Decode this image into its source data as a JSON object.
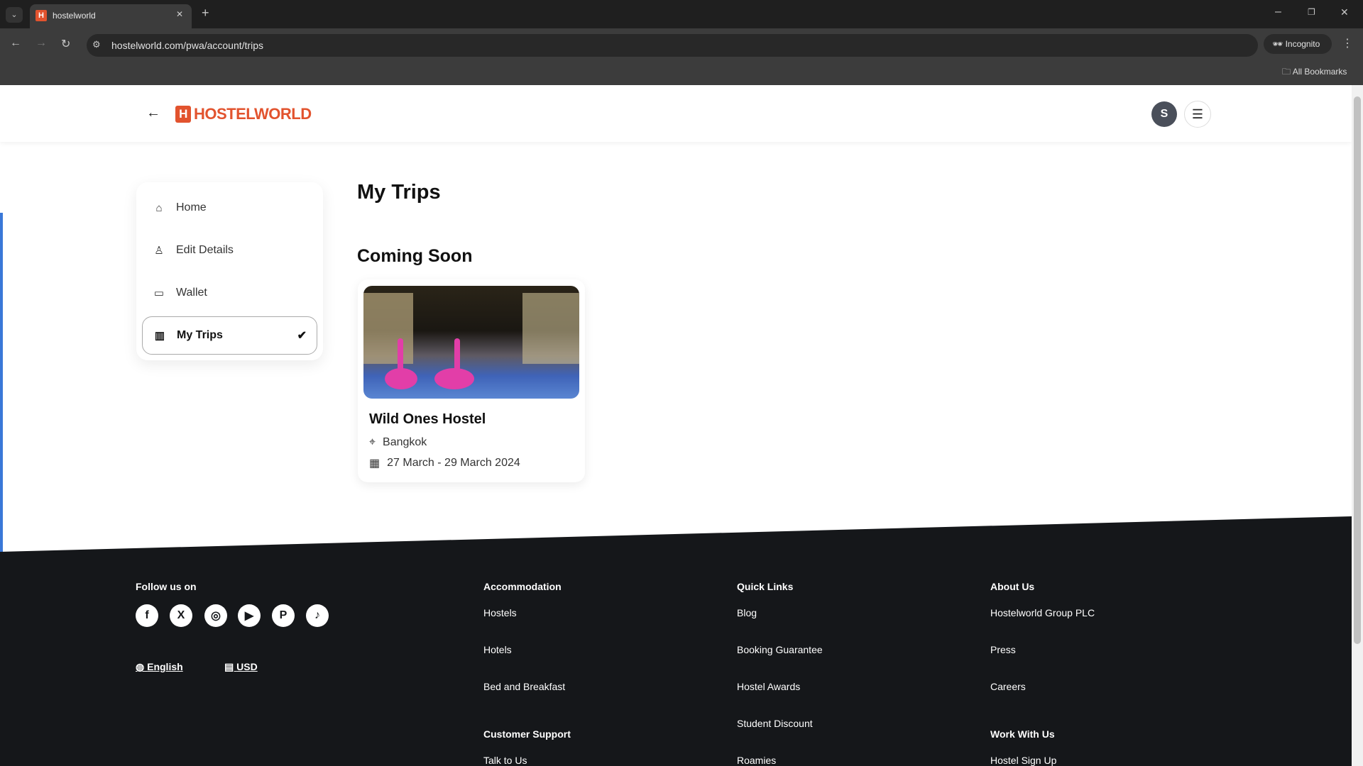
{
  "browser": {
    "tab_title": "hostelworld",
    "url": "hostelworld.com/pwa/account/trips",
    "profile_label": "Incognito",
    "bookmarks_label": "All Bookmarks"
  },
  "header": {
    "logo_text": "HOSTELWORLD",
    "avatar_initial": "S"
  },
  "sidebar": {
    "items": [
      {
        "label": "Home",
        "icon": "home-icon"
      },
      {
        "label": "Edit Details",
        "icon": "user-icon"
      },
      {
        "label": "Wallet",
        "icon": "wallet-icon"
      },
      {
        "label": "My Trips",
        "icon": "map-icon",
        "selected": true
      }
    ]
  },
  "main": {
    "title": "My Trips",
    "section": "Coming Soon",
    "trip": {
      "name": "Wild Ones Hostel",
      "city": "Bangkok",
      "dates": "27 March - 29 March 2024"
    }
  },
  "footer": {
    "follow": "Follow us on",
    "socials": [
      "facebook",
      "x",
      "instagram",
      "youtube",
      "pinterest",
      "tiktok"
    ],
    "language": "English",
    "currency": "USD",
    "accommodation": {
      "title": "Accommodation",
      "links": [
        "Hostels",
        "Hotels",
        "Bed and Breakfast"
      ]
    },
    "support": {
      "title": "Customer Support",
      "links": [
        "Talk to Us"
      ]
    },
    "quick": {
      "title": "Quick Links",
      "links": [
        "Blog",
        "Booking Guarantee",
        "Hostel Awards",
        "Student Discount",
        "Roamies"
      ]
    },
    "about": {
      "title": "About Us",
      "links": [
        "Hostelworld Group PLC",
        "Press",
        "Careers"
      ]
    },
    "work": {
      "title": "Work With Us",
      "links": [
        "Hostel Sign Up"
      ]
    }
  },
  "colors": {
    "brand": "#e2532e",
    "footer_bg": "#15171a"
  }
}
